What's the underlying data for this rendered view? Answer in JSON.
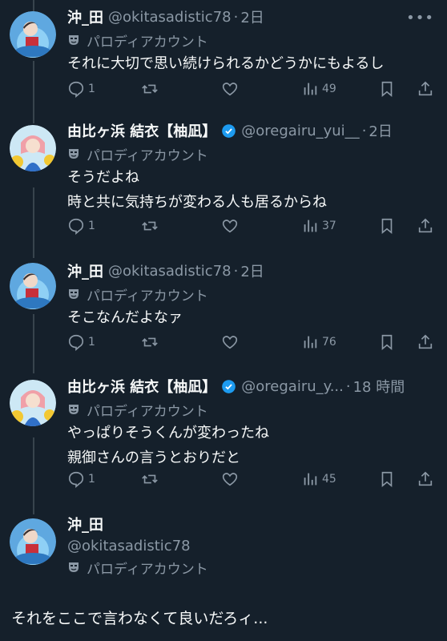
{
  "parody_label": "パロディアカウント",
  "tweets": [
    {
      "name": "沖_田",
      "handle": "@okitasadistic78",
      "time": "2日",
      "verified": false,
      "lines": [
        "それに大切で思い続けられるかどうかにもよるし"
      ],
      "replies": "1",
      "views": "49"
    },
    {
      "name": "由比ヶ浜 結衣【柚凪】",
      "handle": "@oregairu_yui__",
      "time": "2日",
      "verified": true,
      "lines": [
        "そうだよね",
        "時と共に気持ちが変わる人も居るからね"
      ],
      "replies": "1",
      "views": "37"
    },
    {
      "name": "沖_田",
      "handle": "@okitasadistic78",
      "time": "2日",
      "verified": false,
      "lines": [
        "そこなんだよなァ"
      ],
      "replies": "1",
      "views": "76"
    },
    {
      "name": "由比ヶ浜 結衣【柚凪】",
      "handle": "@oregairu_y...",
      "time": "18 時間",
      "verified": true,
      "lines": [
        "やっぱりそうくんが変わったね",
        "親御さんの言うとおりだと"
      ],
      "replies": "1",
      "views": "45"
    }
  ],
  "main_tweet": {
    "name": "沖_田",
    "handle": "@okitasadistic78",
    "text": "それをここで言わなくて良いだろィ..."
  },
  "colors": {
    "background": "#15202b",
    "secondary_text": "#8b98a5",
    "verified": "#1d9bf0"
  }
}
